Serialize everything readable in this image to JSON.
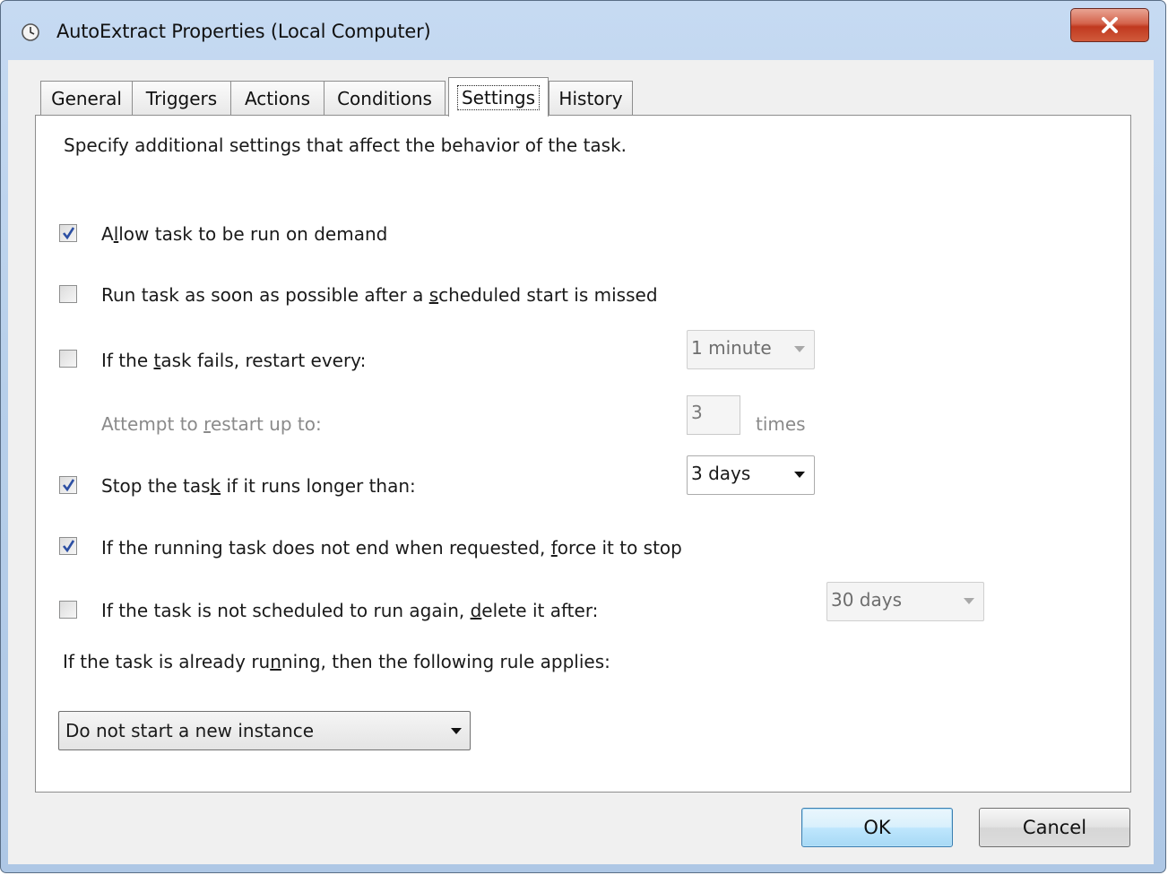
{
  "window": {
    "title": "AutoExtract Properties (Local Computer)",
    "title_icon": "clock-icon",
    "close_icon": "close-icon"
  },
  "tabs": [
    {
      "label": "General",
      "active": false
    },
    {
      "label": "Triggers",
      "active": false
    },
    {
      "label": "Actions",
      "active": false
    },
    {
      "label": "Conditions",
      "active": false
    },
    {
      "label": "Settings",
      "active": true
    },
    {
      "label": "History",
      "active": false
    }
  ],
  "settings": {
    "intro": "Specify additional settings that affect the behavior of the task.",
    "allow_on_demand": {
      "label_pre": "A",
      "label_key": "l",
      "label_post": "low task to be run on demand",
      "checked": true
    },
    "run_missed": {
      "label_pre": "Run task as soon as possible after a ",
      "label_key": "s",
      "label_post": "cheduled start is missed",
      "checked": false
    },
    "restart_on_fail": {
      "label_pre": "If the ",
      "label_key": "t",
      "label_post": "ask fails, restart every:",
      "checked": false,
      "interval": "1 minute"
    },
    "restart_attempts": {
      "label_pre": "Attempt to ",
      "label_key": "r",
      "label_post": "estart up to:",
      "count": "3",
      "unit": "times"
    },
    "stop_if_long": {
      "label_pre": "Stop the tas",
      "label_key": "k",
      "label_post": " if it runs longer than:",
      "checked": true,
      "duration": "3 days"
    },
    "force_stop": {
      "label_pre": "If the running task does not end when requested, ",
      "label_key": "f",
      "label_post": "orce it to stop",
      "checked": true
    },
    "delete_if_not_scheduled": {
      "label_pre": "If the task is not scheduled to run again, ",
      "label_key": "d",
      "label_post": "elete it after:",
      "checked": false,
      "duration": "30 days"
    },
    "running_rule": {
      "label_pre": "If the task is already ru",
      "label_key": "n",
      "label_post": "ning, then the following rule applies:",
      "value": "Do not start a new instance"
    }
  },
  "buttons": {
    "ok": "OK",
    "cancel": "Cancel"
  },
  "colors": {
    "accent_blue": "#3c7fb1",
    "check_blue": "#2c4fa3"
  }
}
